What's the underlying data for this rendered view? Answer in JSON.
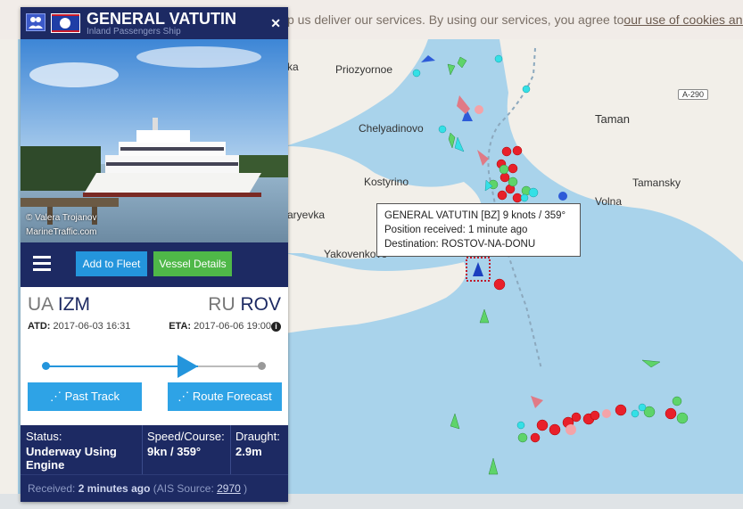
{
  "cookie": {
    "message": "p us deliver our services. By using our services, you agree to",
    "link": "our use of cookies and lo"
  },
  "map": {
    "places": [
      {
        "name": "Priozyornoe"
      },
      {
        "name": "Chelyadinovo"
      },
      {
        "name": "Taman"
      },
      {
        "name": "Kostyrino"
      },
      {
        "name": "Tamansky"
      },
      {
        "name": "Volna"
      },
      {
        "name": "aryevka"
      },
      {
        "name": "Yakovenkovo"
      },
      {
        "name": "rka"
      }
    ],
    "road": "A-290",
    "tooltip": {
      "line1": "GENERAL VATUTIN [BZ] 9 knots / 359°",
      "line2": "Position received: 1 minute ago",
      "line3": "Destination: ROSTOV-NA-DONU"
    },
    "colors": {
      "water": "#a9d3eb",
      "land": "#f2efe9"
    }
  },
  "vessel": {
    "name": "GENERAL VATUTIN",
    "type": "Inland Passengers Ship",
    "flag_icon": "belize-flag-icon",
    "photo_credit": "© Valera Trojanov",
    "photo_site": "MarineTraffic.com"
  },
  "actions": {
    "add_fleet": "Add to Fleet",
    "details": "Vessel Details"
  },
  "route": {
    "from_country": "UA",
    "from_port": "IZM",
    "to_country": "RU",
    "to_port": "ROV",
    "atd_label": "ATD:",
    "atd_value": "2017-06-03 16:31",
    "eta_label": "ETA:",
    "eta_value": "2017-06-06 19:00",
    "progress": 0.7,
    "past_track": "Past Track",
    "route_forecast": "Route Forecast"
  },
  "status": {
    "status_label": "Status:",
    "status_value": "Underway Using Engine",
    "speed_label": "Speed/Course:",
    "speed_value": "9kn / 359°",
    "draught_label": "Draught:",
    "draught_value": "2.9m"
  },
  "received": {
    "prefix": "Received:",
    "time": "2 minutes ago",
    "source_prefix": "(AIS Source:",
    "source": "2970",
    "suffix": ")"
  }
}
